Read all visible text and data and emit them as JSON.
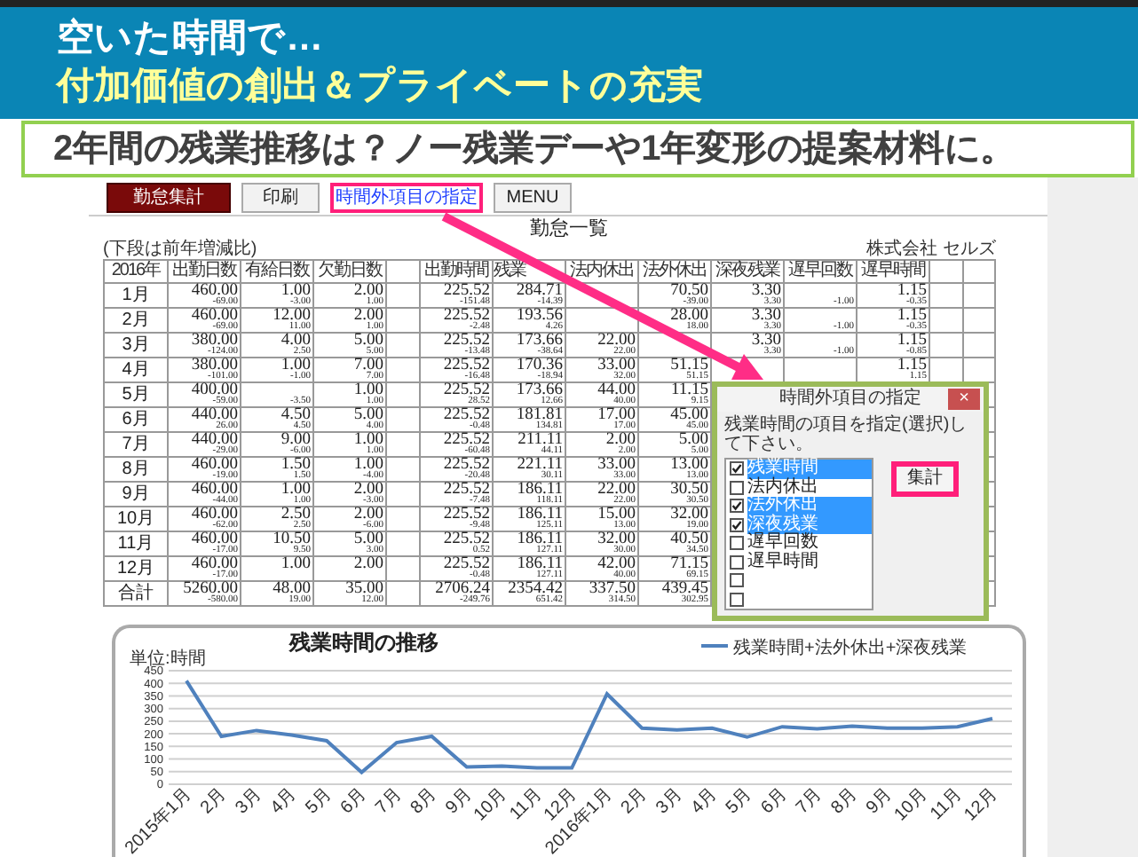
{
  "slide": {
    "title_line_1": "空いた時間で…",
    "title_line_2": "付加価値の創出＆プライベートの充実",
    "subtitle": "2年間の残業推移は？ノー残業デーや1年変形の提案材料に。"
  },
  "toolbar": [
    {
      "label": "勤怠集計",
      "kind": "primary"
    },
    {
      "label": "印刷",
      "kind": "plain"
    },
    {
      "label": "時間外項目の指定",
      "kind": "highlighted"
    },
    {
      "label": "MENU",
      "kind": "plain"
    }
  ],
  "report": {
    "title": "勤怠一覧",
    "note": "(下段は前年増減比)",
    "company": "株式会社 セルズ",
    "columns": [
      {
        "label": "2016年"
      },
      {
        "label": "出勤日数"
      },
      {
        "label": "有給日数"
      },
      {
        "label": "欠勤日数"
      },
      {},
      {
        "label": "出勤時間"
      },
      {
        "label": "残業"
      },
      {
        "label": "法内休出"
      },
      {
        "label": "法外休出"
      },
      {
        "label": "深夜残業"
      },
      {
        "label": "遅早回数"
      },
      {
        "label": "遅早時間"
      },
      {},
      {}
    ],
    "rows": [
      {
        "cells": [
          "1月",
          [
            "460.00",
            "-69.00"
          ],
          [
            "1.00",
            "-3.00"
          ],
          [
            "2.00",
            "1.00"
          ],
          null,
          [
            "225.52",
            "-151.48"
          ],
          [
            "284.71",
            "-14.39"
          ],
          null,
          [
            "70.50",
            "-39.00"
          ],
          [
            "3.30",
            "3.30"
          ],
          [
            null,
            "-1.00"
          ],
          [
            "1.15",
            "-0.35"
          ],
          null,
          null
        ]
      },
      {
        "cells": [
          "2月",
          [
            "460.00",
            "-69.00"
          ],
          [
            "12.00",
            "11.00"
          ],
          [
            "2.00",
            "1.00"
          ],
          null,
          [
            "225.52",
            "-2.48"
          ],
          [
            "193.56",
            "4.26"
          ],
          null,
          [
            "28.00",
            "18.00"
          ],
          [
            "3.30",
            "3.30"
          ],
          [
            null,
            "-1.00"
          ],
          [
            "1.15",
            "-0.35"
          ],
          null,
          null
        ]
      },
      {
        "cells": [
          "3月",
          [
            "380.00",
            "-124.00"
          ],
          [
            "4.00",
            "2.50"
          ],
          [
            "5.00",
            "5.00"
          ],
          null,
          [
            "225.52",
            "-13.48"
          ],
          [
            "173.66",
            "-38.64"
          ],
          [
            "22.00",
            "22.00"
          ],
          null,
          [
            "3.30",
            "3.30"
          ],
          [
            null,
            "-1.00"
          ],
          [
            "1.15",
            "-0.85"
          ],
          null,
          null
        ]
      },
      {
        "cells": [
          "4月",
          [
            "380.00",
            "-101.00"
          ],
          [
            "1.00",
            "-1.00"
          ],
          [
            "7.00",
            "7.00"
          ],
          null,
          [
            "225.52",
            "-16.48"
          ],
          [
            "170.36",
            "-18.94"
          ],
          [
            "33.00",
            "32.00"
          ],
          [
            "51.15",
            "51.15"
          ],
          null,
          null,
          [
            "1.15",
            "1.15"
          ],
          null,
          null
        ]
      },
      {
        "cells": [
          "5月",
          [
            "400.00",
            "-59.00"
          ],
          [
            null,
            "-3.50"
          ],
          [
            "1.00",
            "1.00"
          ],
          null,
          [
            "225.52",
            "28.52"
          ],
          [
            "173.66",
            "12.66"
          ],
          [
            "44.00",
            "40.00"
          ],
          [
            "11.15",
            "9.15"
          ],
          null,
          null,
          null,
          null,
          null
        ]
      },
      {
        "cells": [
          "6月",
          [
            "440.00",
            "26.00"
          ],
          [
            "4.50",
            "4.50"
          ],
          [
            "5.00",
            "4.00"
          ],
          null,
          [
            "225.52",
            "-0.48"
          ],
          [
            "181.81",
            "134.81"
          ],
          [
            "17.00",
            "17.00"
          ],
          [
            "45.00",
            "45.00"
          ],
          null,
          null,
          null,
          null,
          null
        ]
      },
      {
        "cells": [
          "7月",
          [
            "440.00",
            "-29.00"
          ],
          [
            "9.00",
            "-6.00"
          ],
          [
            "1.00",
            "1.00"
          ],
          null,
          [
            "225.52",
            "-60.48"
          ],
          [
            "211.11",
            "44.11"
          ],
          [
            "2.00",
            "2.00"
          ],
          [
            "5.00",
            "5.00"
          ],
          null,
          null,
          null,
          null,
          null
        ]
      },
      {
        "cells": [
          "8月",
          [
            "460.00",
            "-19.00"
          ],
          [
            "1.50",
            "1.50"
          ],
          [
            "1.00",
            "-4.00"
          ],
          null,
          [
            "225.52",
            "-20.48"
          ],
          [
            "221.11",
            "30.11"
          ],
          [
            "33.00",
            "33.00"
          ],
          [
            "13.00",
            "13.00"
          ],
          null,
          null,
          null,
          null,
          null
        ]
      },
      {
        "cells": [
          "9月",
          [
            "460.00",
            "-44.00"
          ],
          [
            "1.00",
            "1.00"
          ],
          [
            "2.00",
            "-3.00"
          ],
          null,
          [
            "225.52",
            "-7.48"
          ],
          [
            "186.11",
            "118.11"
          ],
          [
            "22.00",
            "22.00"
          ],
          [
            "30.50",
            "30.50"
          ],
          null,
          null,
          null,
          null,
          null
        ]
      },
      {
        "cells": [
          "10月",
          [
            "460.00",
            "-62.00"
          ],
          [
            "2.50",
            "2.50"
          ],
          [
            "2.00",
            "-6.00"
          ],
          null,
          [
            "225.52",
            "-9.48"
          ],
          [
            "186.11",
            "125.11"
          ],
          [
            "15.00",
            "13.00"
          ],
          [
            "32.00",
            "19.00"
          ],
          null,
          null,
          null,
          null,
          null
        ]
      },
      {
        "cells": [
          "11月",
          [
            "460.00",
            "-17.00"
          ],
          [
            "10.50",
            "9.50"
          ],
          [
            "5.00",
            "3.00"
          ],
          null,
          [
            "225.52",
            "0.52"
          ],
          [
            "186.11",
            "127.11"
          ],
          [
            "32.00",
            "30.00"
          ],
          [
            "40.50",
            "34.50"
          ],
          null,
          null,
          null,
          null,
          null
        ]
      },
      {
        "cells": [
          "12月",
          [
            "460.00",
            "-17.00"
          ],
          [
            "1.00",
            null
          ],
          [
            "2.00",
            null
          ],
          null,
          [
            "225.52",
            "-0.48"
          ],
          [
            "186.11",
            "127.11"
          ],
          [
            "42.00",
            "40.00"
          ],
          [
            "71.15",
            "69.15"
          ],
          null,
          null,
          null,
          null,
          null
        ]
      },
      {
        "cells": [
          "合計",
          [
            "5260.00",
            "-580.00"
          ],
          [
            "48.00",
            "19.00"
          ],
          [
            "35.00",
            "12.00"
          ],
          null,
          [
            "2706.24",
            "-249.76"
          ],
          [
            "2354.42",
            "651.42"
          ],
          [
            "337.50",
            "314.50"
          ],
          [
            "439.45",
            "302.95"
          ],
          null,
          null,
          null,
          null,
          null
        ]
      }
    ]
  },
  "dialog": {
    "title": "時間外項目の指定",
    "close_label": "×",
    "instruction": "残業時間の項目を指定(選択)して下さい。",
    "button": "集計",
    "items": [
      {
        "label": "残業時間",
        "checked": true,
        "selected": true
      },
      {
        "label": "法内休出",
        "checked": false,
        "selected": false
      },
      {
        "label": "法外休出",
        "checked": true,
        "selected": true
      },
      {
        "label": "深夜残業",
        "checked": true,
        "selected": true
      },
      {
        "label": "遅早回数",
        "checked": false,
        "selected": false
      },
      {
        "label": "遅早時間",
        "checked": false,
        "selected": false
      },
      {
        "checked": false,
        "selected": false
      },
      {
        "checked": false,
        "selected": false
      }
    ]
  },
  "chart": {
    "chart_data": {
      "type": "line",
      "title": "残業時間の推移",
      "ylabel": "単位:時間",
      "grid": true,
      "categories": [
        "2015年1月",
        "2月",
        "3月",
        "4月",
        "5月",
        "6月",
        "7月",
        "8月",
        "9月",
        "10月",
        "11月",
        "12月",
        "2016年1月",
        "2月",
        "3月",
        "4月",
        "5月",
        "6月",
        "7月",
        "8月",
        "9月",
        "10月",
        "11月",
        "12月"
      ],
      "series": [
        {
          "name": "残業時間+法外休出+深夜残業",
          "color": "#4f81bd",
          "values": [
            410,
            190,
            213,
            195,
            172,
            47,
            165,
            190,
            68,
            72,
            65,
            65,
            358,
            222,
            215,
            222,
            187,
            228,
            220,
            230,
            222,
            222,
            228,
            260
          ]
        }
      ],
      "ylim": [
        0,
        450
      ],
      "yticks": [
        0,
        50,
        100,
        150,
        200,
        250,
        300,
        350,
        400,
        450
      ]
    }
  }
}
